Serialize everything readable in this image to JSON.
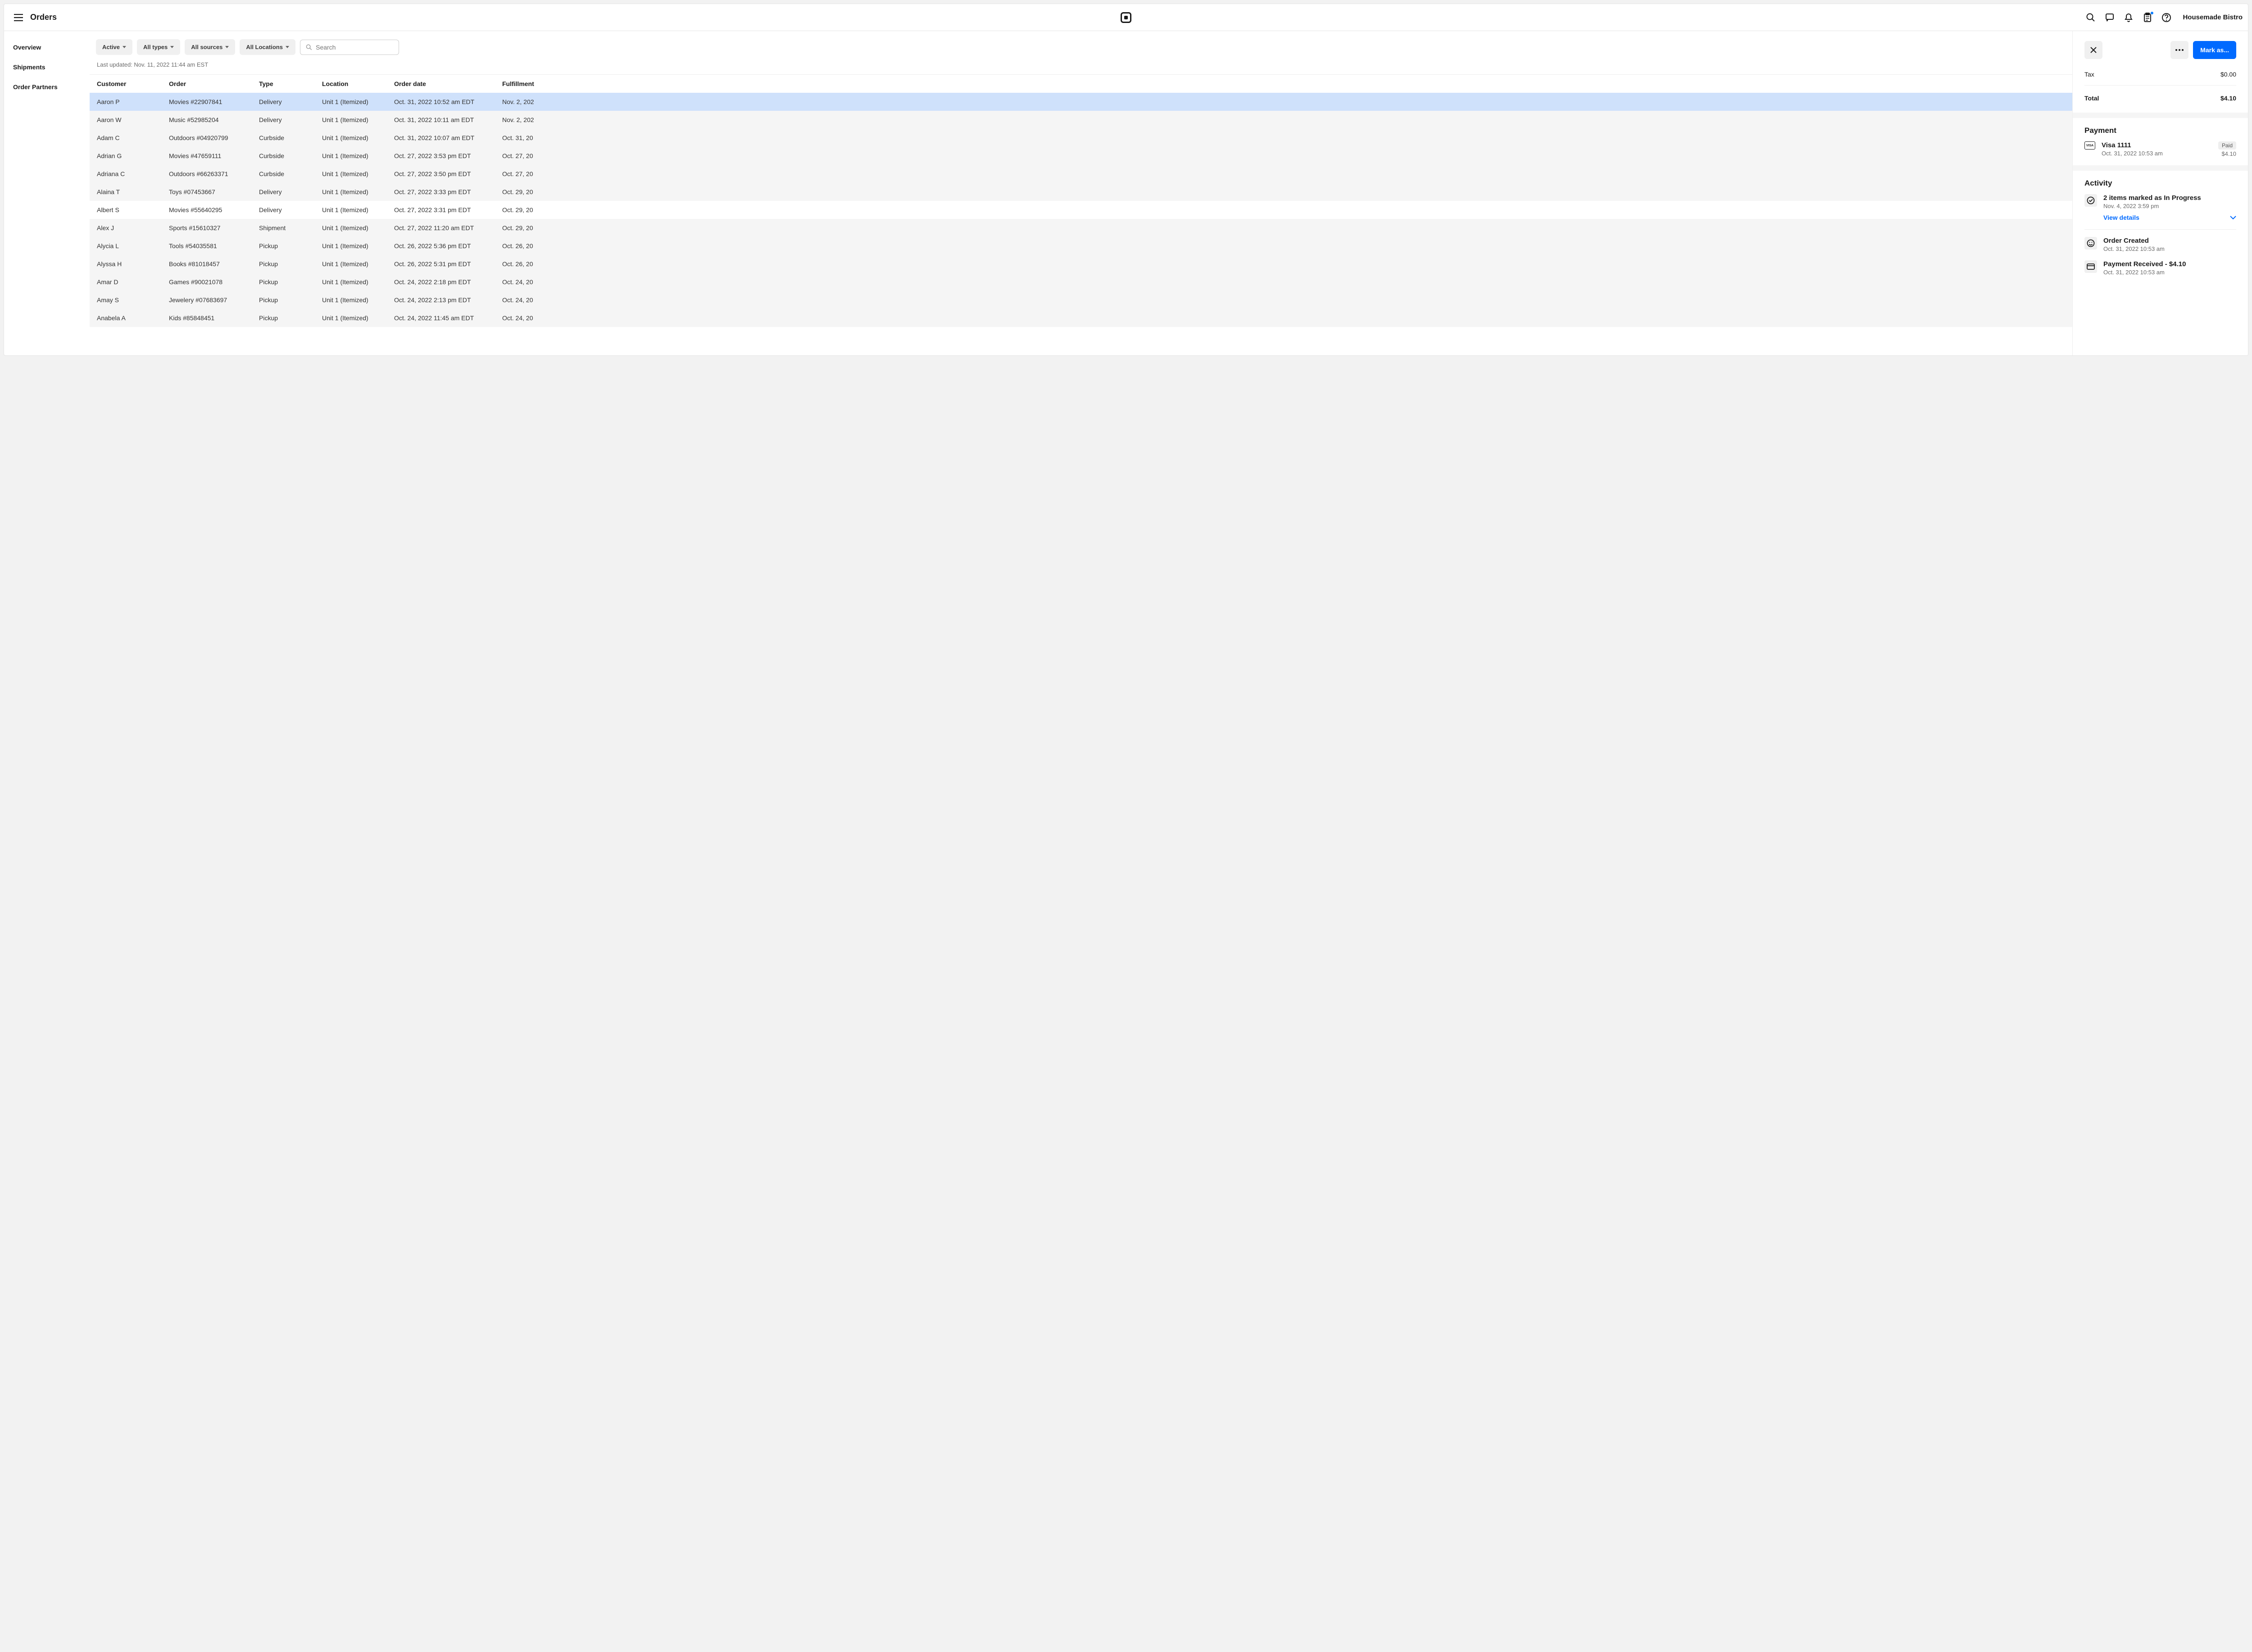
{
  "topbar": {
    "title": "Orders",
    "account": "Housemade Bistro"
  },
  "sidenav": {
    "overview": "Overview",
    "shipments": "Shipments",
    "partners": "Order Partners"
  },
  "filters": {
    "active": "Active",
    "types": "All types",
    "sources": "All sources",
    "locations": "All Locations",
    "search_placeholder": "Search"
  },
  "updated": "Last updated: Nov. 11, 2022 11:44 am EST",
  "columns": {
    "customer": "Customer",
    "order": "Order",
    "type": "Type",
    "location": "Location",
    "date": "Order date",
    "fulfillment": "Fulfillment"
  },
  "rows": [
    {
      "c": "Aaron P",
      "o": "Movies #22907841",
      "t": "Delivery",
      "l": "Unit 1 (Itemized)",
      "d": "Oct. 31, 2022 10:52 am EDT",
      "f": "Nov. 2, 202",
      "sel": true,
      "stripe": false
    },
    {
      "c": "Aaron W",
      "o": "Music #52985204",
      "t": "Delivery",
      "l": "Unit 1 (Itemized)",
      "d": "Oct. 31, 2022 10:11 am EDT",
      "f": "Nov. 2, 202",
      "stripe": true
    },
    {
      "c": "Adam C",
      "o": "Outdoors #04920799",
      "t": "Curbside",
      "l": "Unit 1 (Itemized)",
      "d": "Oct. 31, 2022 10:07 am EDT",
      "f": "Oct. 31, 20",
      "stripe": true
    },
    {
      "c": "Adrian G",
      "o": "Movies #47659111",
      "t": "Curbside",
      "l": "Unit 1 (Itemized)",
      "d": "Oct. 27, 2022 3:53 pm EDT",
      "f": "Oct. 27, 20",
      "stripe": true
    },
    {
      "c": "Adriana C",
      "o": "Outdoors #66263371",
      "t": "Curbside",
      "l": "Unit 1 (Itemized)",
      "d": "Oct. 27, 2022 3:50 pm EDT",
      "f": "Oct. 27, 20",
      "stripe": true
    },
    {
      "c": "Alaina T",
      "o": "Toys #07453667",
      "t": "Delivery",
      "l": "Unit 1 (Itemized)",
      "d": "Oct. 27, 2022 3:33 pm EDT",
      "f": "Oct. 29, 20",
      "stripe": true
    },
    {
      "c": "Albert S",
      "o": "Movies #55640295",
      "t": "Delivery",
      "l": "Unit 1 (Itemized)",
      "d": "Oct. 27, 2022 3:31 pm EDT",
      "f": "Oct. 29, 20",
      "stripe": false
    },
    {
      "c": "Alex J",
      "o": "Sports #15610327",
      "t": "Shipment",
      "l": "Unit 1 (Itemized)",
      "d": "Oct. 27, 2022 11:20 am EDT",
      "f": "Oct. 29, 20",
      "stripe": true
    },
    {
      "c": "Alycia L",
      "o": "Tools #54035581",
      "t": "Pickup",
      "l": "Unit 1 (Itemized)",
      "d": "Oct. 26, 2022 5:36 pm EDT",
      "f": "Oct. 26, 20",
      "stripe": true
    },
    {
      "c": "Alyssa H",
      "o": "Books #81018457",
      "t": "Pickup",
      "l": "Unit 1 (Itemized)",
      "d": "Oct. 26, 2022 5:31 pm EDT",
      "f": "Oct. 26, 20",
      "stripe": true
    },
    {
      "c": "Amar D",
      "o": "Games #90021078",
      "t": "Pickup",
      "l": "Unit 1 (Itemized)",
      "d": "Oct. 24, 2022 2:18 pm EDT",
      "f": "Oct. 24, 20",
      "stripe": true
    },
    {
      "c": "Amay S",
      "o": "Jewelery #07683697",
      "t": "Pickup",
      "l": "Unit 1 (Itemized)",
      "d": "Oct. 24, 2022 2:13 pm EDT",
      "f": "Oct. 24, 20",
      "stripe": true
    },
    {
      "c": "Anabela A",
      "o": "Kids #85848451",
      "t": "Pickup",
      "l": "Unit 1 (Itemized)",
      "d": "Oct. 24, 2022 11:45 am EDT",
      "f": "Oct. 24, 20",
      "stripe": true
    }
  ],
  "panel": {
    "mark": "Mark as...",
    "tax_label": "Tax",
    "tax_value": "$0.00",
    "total_label": "Total",
    "total_value": "$4.10",
    "payment_title": "Payment",
    "payment": {
      "name": "Visa 1111",
      "date": "Oct. 31, 2022 10:53 am",
      "badge": "Paid",
      "amount": "$4.10"
    },
    "activity_title": "Activity",
    "activity": [
      {
        "title": "2 items marked as In Progress",
        "date": "Nov. 4, 2022 3:59 pm",
        "details": "View details"
      },
      {
        "title": "Order Created",
        "date": "Oct. 31, 2022 10:53 am"
      },
      {
        "title": "Payment Received - $4.10",
        "date": "Oct. 31, 2022 10:53 am"
      }
    ]
  }
}
